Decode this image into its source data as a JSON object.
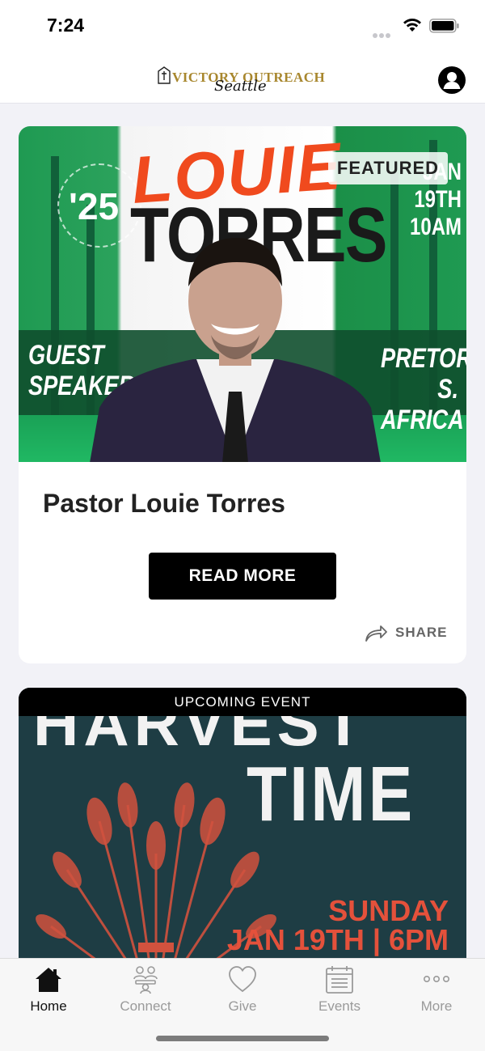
{
  "status_bar": {
    "time": "7:24"
  },
  "header": {
    "logo_text": "VICTORY OUTREACH",
    "logo_script": "Seattle"
  },
  "featured_card": {
    "badge": "FEATURED",
    "title": "Pastor Louie Torres",
    "read_more_label": "READ MORE",
    "share_label": "SHARE",
    "art": {
      "name_line_1": "LOUIE",
      "name_line_2": "TORRES",
      "year": "'25",
      "date_lines": [
        "JAN",
        "19TH",
        "10AM"
      ],
      "guest_lines": [
        "GUEST",
        "SPEAKER"
      ],
      "place_lines": [
        "PRETORIA",
        "S. AFRICA"
      ],
      "colors": {
        "green": "#1f9a52",
        "orange": "#f04a1e"
      }
    }
  },
  "event_card": {
    "ribbon": "UPCOMING EVENT",
    "art": {
      "title_top": "HARVEST",
      "title": "TIME",
      "day": "SUNDAY",
      "date": "JAN 19TH | 6PM",
      "colors": {
        "background": "#1e3d44",
        "accent": "#e4513b"
      }
    }
  },
  "tabs": [
    {
      "label": "Home",
      "icon": "home-icon",
      "active": true
    },
    {
      "label": "Connect",
      "icon": "connect-icon",
      "active": false
    },
    {
      "label": "Give",
      "icon": "heart-icon",
      "active": false
    },
    {
      "label": "Events",
      "icon": "calendar-icon",
      "active": false
    },
    {
      "label": "More",
      "icon": "more-icon",
      "active": false
    }
  ]
}
